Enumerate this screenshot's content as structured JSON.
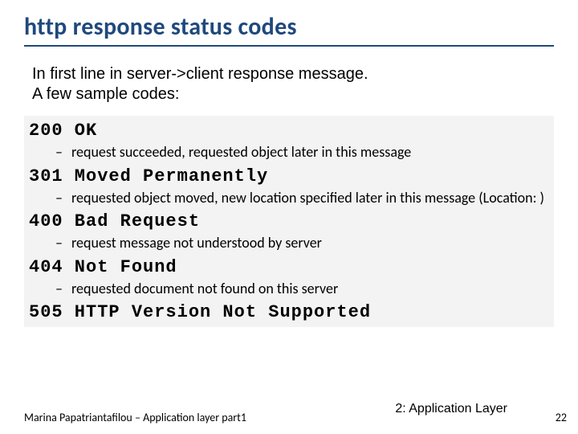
{
  "title": "http response status codes",
  "intro_line1": "In first line in server->client response message.",
  "intro_line2": "A few sample codes:",
  "codes": [
    {
      "code": "200 OK",
      "desc": "request succeeded, requested object later in this message"
    },
    {
      "code": "301 Moved Permanently",
      "desc": "requested object moved, new location specified later in this message (Location: )"
    },
    {
      "code": "400 Bad Request",
      "desc": "request message not understood by server"
    },
    {
      "code": "404 Not Found",
      "desc": "requested document not found on this server"
    },
    {
      "code": "505 HTTP Version Not Supported",
      "desc": ""
    }
  ],
  "footer_left": "Marina Papatriantafilou – Application layer part1",
  "footer_right": "2: Application Layer",
  "page_number": "22"
}
